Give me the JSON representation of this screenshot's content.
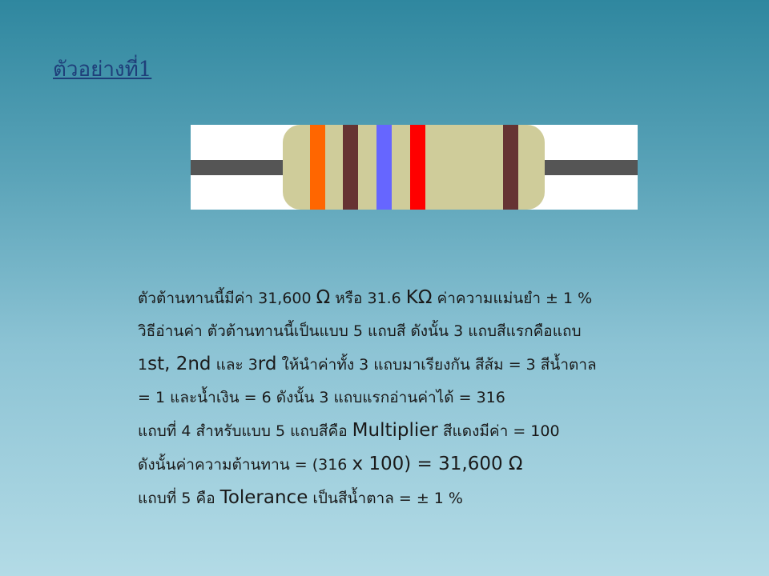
{
  "title": "ตัวอย่างที่1",
  "resistor": {
    "body_color": "#cfcc9a",
    "lead_color": "#555555",
    "bands": [
      {
        "name": "band-1",
        "color": "#ff6600"
      },
      {
        "name": "band-2",
        "color": "#663333"
      },
      {
        "name": "band-3",
        "color": "#6666ff"
      },
      {
        "name": "band-4",
        "color": "#ff0000"
      },
      {
        "name": "band-5",
        "color": "#663333"
      }
    ]
  },
  "lines": {
    "l1": {
      "a": "ตัวต้านทานนี้มีค่า 31,600 ",
      "b": "Ω",
      "c": " หรือ 31.6 ",
      "d": "KΩ",
      "e": " ค่าความแม่นยำ ± 1 %"
    },
    "l2": "วิธีอ่านค่า ตัวต้านทานนี้เป็นแบบ 5 แถบสี ดังนั้น 3 แถบสีแรกคือแถบ",
    "l3": {
      "a": "1",
      "b": "st, 2nd",
      "c": " และ 3",
      "d": "rd",
      "e": " ให้นำค่าทั้ง 3 แถบมาเรียงกัน สีส้ม = 3 สีน้ำตาล"
    },
    "l4": "= 1 และน้ำเงิน = 6 ดังนั้น 3 แถบแรกอ่านค่าได้ = 316",
    "l5": {
      "a": "แถบที่ 4 สำหรับแบบ 5 แถบสีคือ ",
      "b": "Multiplier",
      "c": " สีแดงมีค่า = 100"
    },
    "l6": {
      "a": "ดังนั้นค่าความต้านทาน = (316 ",
      "b": "x 100) = 31,600 Ω"
    },
    "l7": {
      "a": "แถบที่ 5 คือ ",
      "b": "Tolerance",
      "c": " เป็นสีน้ำตาล = ± 1 %"
    }
  }
}
